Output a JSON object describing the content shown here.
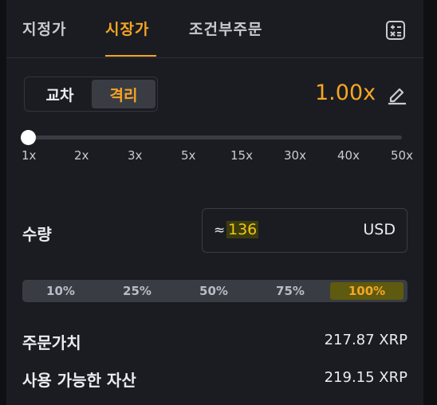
{
  "tabs": [
    {
      "label": "지정가"
    },
    {
      "label": "시장가"
    },
    {
      "label": "조건부주문"
    }
  ],
  "active_tab": "시장가",
  "margin_mode": {
    "options": [
      {
        "label": "교차"
      },
      {
        "label": "격리"
      }
    ],
    "selected": "격리"
  },
  "leverage": {
    "value": "1.00x",
    "ticks": [
      "1x",
      "2x",
      "3x",
      "5x",
      "15x",
      "30x",
      "40x",
      "50x"
    ],
    "slider_position": 0
  },
  "quantity": {
    "label": "수량",
    "approx_symbol": "≈",
    "value": "136",
    "unit": "USD"
  },
  "percent_options": [
    "10%",
    "25%",
    "50%",
    "75%",
    "100%"
  ],
  "selected_percent": "100%",
  "summary": [
    {
      "label": "주문가치",
      "value": "217.87 XRP"
    },
    {
      "label": "사용 가능한 자산",
      "value": "219.15 XRP"
    }
  ],
  "colors": {
    "accent": "#f5a623",
    "background": "#1b1c22",
    "highlight": "#5e5a0f"
  },
  "icons": [
    "calculator-icon",
    "edit-pencil-icon"
  ]
}
